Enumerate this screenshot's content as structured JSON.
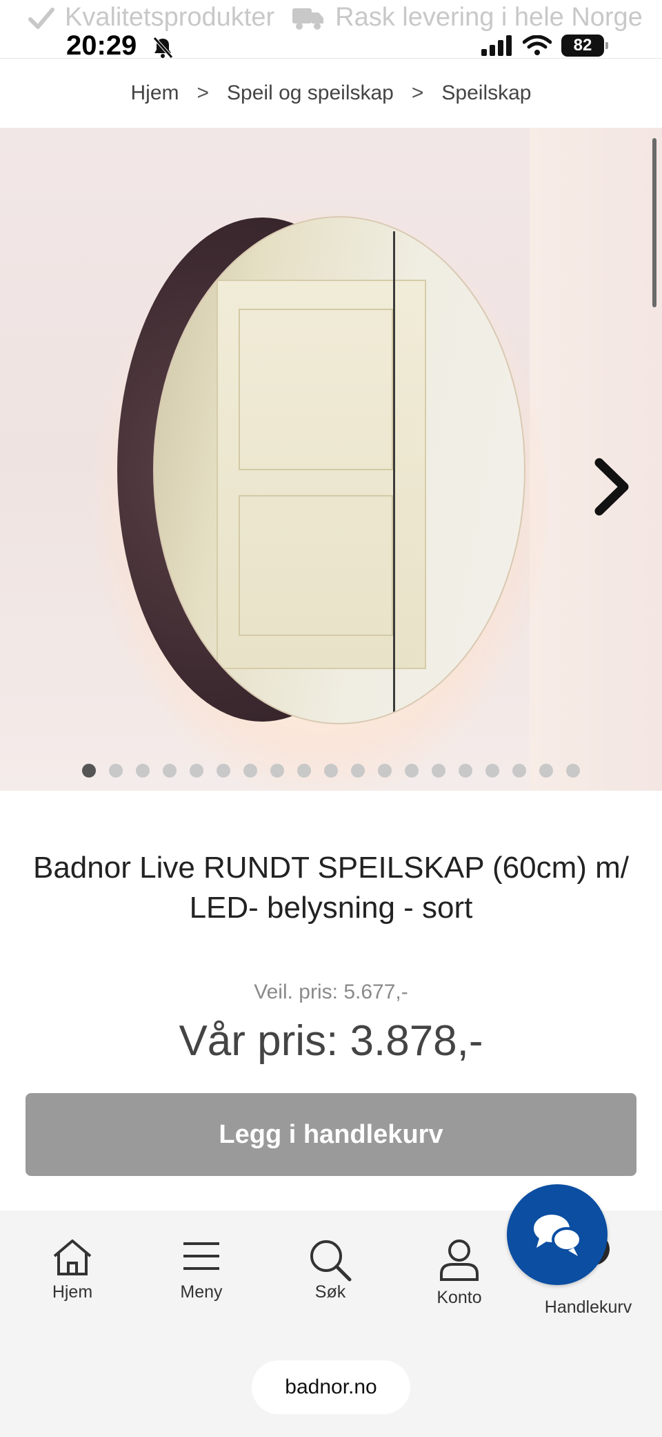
{
  "promo": {
    "text1": "Kvalitetsprodukter",
    "text2": "Rask levering i hele Norge",
    "icons": [
      "check-icon",
      "truck-icon"
    ]
  },
  "status_bar": {
    "time": "20:29",
    "battery": "82"
  },
  "breadcrumb": {
    "items": [
      "Hjem",
      "Speil og speilskap",
      "Speilskap"
    ],
    "separator": ">"
  },
  "gallery": {
    "image_count": 19,
    "active_index": 0
  },
  "product": {
    "title": "Badnor Live RUNDT SPEILSKAP (60cm) m/ LED- belysning - sort",
    "prev_price": "Veil. pris: 5.677,-",
    "our_price": "Vår pris: 3.878,-",
    "cart_button": "Legg i handlekurv"
  },
  "bottom_nav": {
    "items": [
      {
        "label": "Hjem",
        "icon": "home-icon"
      },
      {
        "label": "Meny",
        "icon": "menu-icon"
      },
      {
        "label": "Søk",
        "icon": "search-icon"
      },
      {
        "label": "Konto",
        "icon": "user-icon"
      },
      {
        "label": "Handlekurv",
        "icon": "cart-icon"
      }
    ]
  },
  "browser": {
    "url": "badnor.no"
  },
  "colors": {
    "chat_button": "#0b4ea2",
    "cart_button": "#9a9a9a"
  }
}
